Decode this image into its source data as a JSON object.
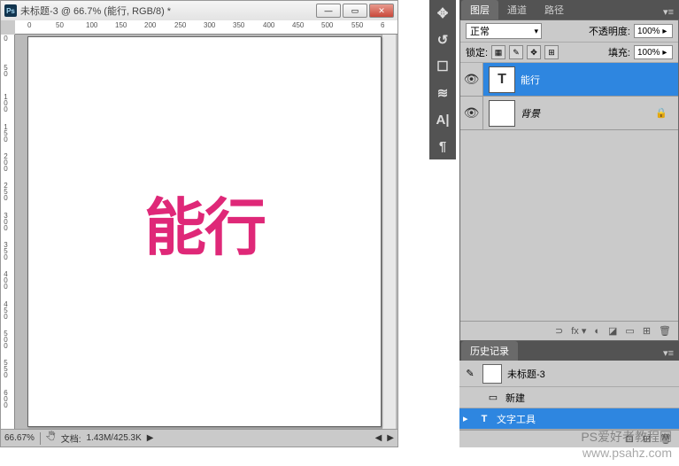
{
  "window": {
    "title": "未标题-3 @ 66.7% (能行, RGB/8) *",
    "min": "—",
    "max": "▭",
    "close": "✕"
  },
  "ruler_h": [
    "0",
    "50",
    "100",
    "150",
    "200",
    "250",
    "300",
    "350",
    "400",
    "450",
    "500",
    "550",
    "6"
  ],
  "ruler_v": [
    "0",
    "50",
    "100",
    "150",
    "200",
    "250",
    "300",
    "350",
    "400",
    "450",
    "500",
    "550",
    "600"
  ],
  "canvas": {
    "text": "能行"
  },
  "status": {
    "zoom": "66.67%",
    "doc_label": "文档:",
    "doc_info": "1.43M/425.3K",
    "arrow": "▶"
  },
  "tools": {
    "t1": "✥",
    "t2": "↺",
    "t3": "☐",
    "t4": "≋",
    "t5": "A|",
    "t6": "¶"
  },
  "panels": {
    "tabs": {
      "layers": "图层",
      "channels": "通道",
      "paths": "路径",
      "menu": "▾≡"
    },
    "blend": {
      "mode": "正常",
      "opacity_label": "不透明度:",
      "opacity": "100% ▸"
    },
    "lock": {
      "label": "锁定:",
      "i1": "▦",
      "i2": "✎",
      "i3": "✥",
      "i4": "⊞",
      "fill_label": "填充:",
      "fill": "100% ▸"
    },
    "layers_list": [
      {
        "name": "能行",
        "thumb": "T",
        "selected": true,
        "locked": false
      },
      {
        "name": "背景",
        "thumb": "",
        "selected": false,
        "locked": true
      }
    ],
    "layer_footer": {
      "i1": "⊃",
      "i2": "fx ▾",
      "i3": "◐",
      "i4": "◪",
      "i5": "▭",
      "i6": "⊞",
      "i7": "🗑"
    },
    "history_tab": "历史记录",
    "history": {
      "doc": "未标题-3",
      "items": [
        {
          "icon": "▭",
          "label": "新建",
          "selected": false
        },
        {
          "icon": "T",
          "label": "文字工具",
          "selected": true
        }
      ]
    },
    "hist_footer": {
      "i1": "⊡",
      "i2": "⊞",
      "i3": "🗑"
    }
  },
  "watermark": {
    "l1": "PS爱好者教程网",
    "l2": "www.psahz.com"
  }
}
